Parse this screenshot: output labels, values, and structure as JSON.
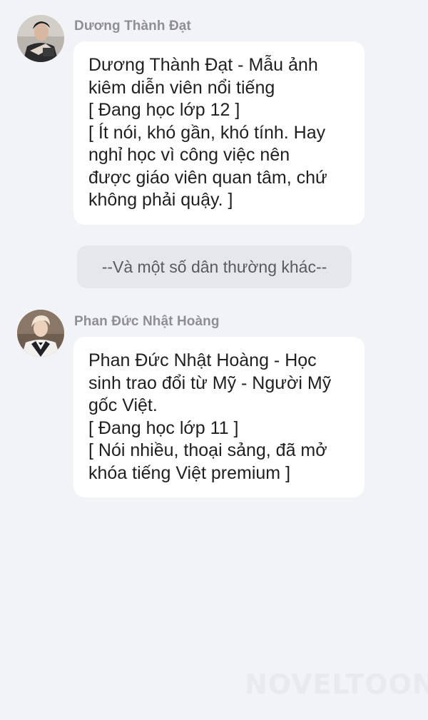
{
  "messages": [
    {
      "sender": "Dương Thành Đạt",
      "lines": [
        "Dương Thành Đạt - Mẫu ảnh",
        "kiêm diễn viên nổi tiếng",
        "[ Đang học lớp 12 ]",
        "[ Ít nói, khó gần, khó tính. Hay",
        "nghỉ học vì công việc nên",
        "được giáo viên quan tâm, chứ",
        "không phải quậy. ]"
      ]
    },
    {
      "sender": "Phan Đức Nhật Hoàng",
      "lines": [
        "Phan Đức Nhật Hoàng - Học",
        "sinh trao đổi từ Mỹ - Người Mỹ",
        "gốc Việt.",
        "[ Đang học lớp 11 ]",
        "[ Nói nhiều, thoại sảng, đã mở",
        "khóa tiếng Việt premium ]"
      ]
    }
  ],
  "narration": "--Và một số dân thường khác--",
  "watermark": "NOVELTOON"
}
